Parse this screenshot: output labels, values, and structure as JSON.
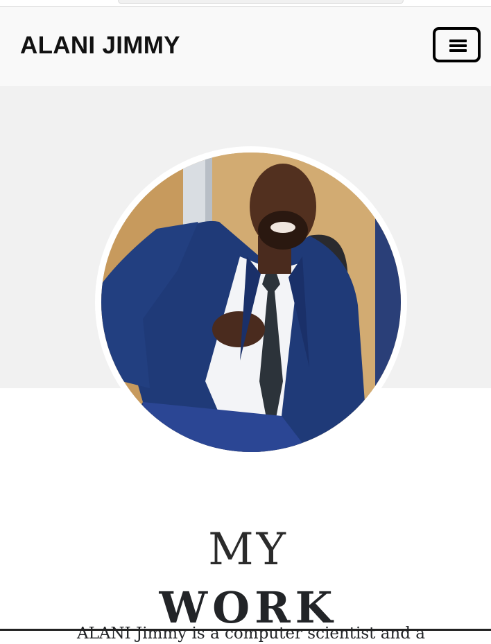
{
  "navbar": {
    "brand": "ALANI JIMMY",
    "menu_icon": "hamburger-menu-icon"
  },
  "hero": {
    "image_subject": "Portrait of a man in a navy suit, white shirt and patterned tie, seated in an office chair"
  },
  "section": {
    "title_light": "MY",
    "title_bold": "WORK",
    "intro": "ALANI Jimmy is a computer scientist and a"
  },
  "colors": {
    "navbar_bg": "#f9f9f9",
    "hero_bg": "#f1f1f1",
    "text_dark": "#222427",
    "suit_navy": "#1f3a78"
  }
}
